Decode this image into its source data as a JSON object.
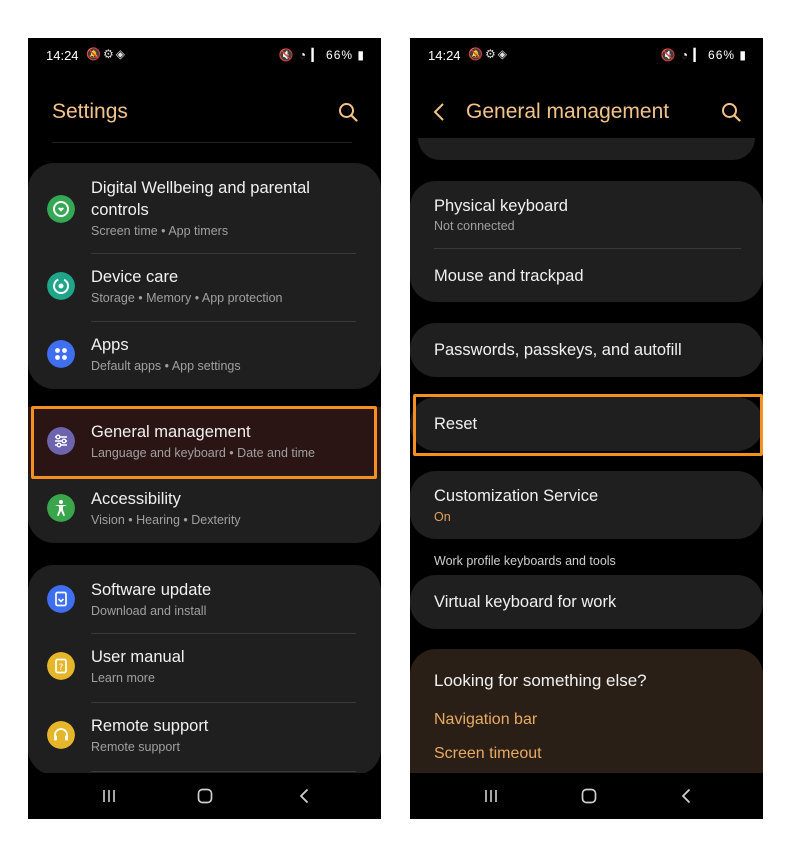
{
  "left": {
    "status": {
      "time": "14:24",
      "battery": "66%"
    },
    "header": {
      "title": "Settings"
    },
    "items": [
      {
        "title_line1": "Digital Wellbeing and parental",
        "title_line2": "controls",
        "sub": "Screen time  •  App timers"
      },
      {
        "title": "Device care",
        "sub": "Storage  •  Memory  •  App protection"
      },
      {
        "title": "Apps",
        "sub": "Default apps  •  App settings"
      },
      {
        "title": "General management",
        "sub": "Language and keyboard  •  Date and time"
      },
      {
        "title": "Accessibility",
        "sub": "Vision  •  Hearing  •  Dexterity"
      },
      {
        "title": "Software update",
        "sub": "Download and install"
      },
      {
        "title": "User manual",
        "sub": "Learn more"
      },
      {
        "title": "Remote support",
        "sub": "Remote support"
      }
    ],
    "icon_colors": {
      "digital_wellbeing": "#34a853",
      "device_care": "#1ea58a",
      "apps": "#3f6ff0",
      "general_management": "#6e64ad",
      "accessibility": "#3aa54a",
      "software_update": "#3f6ff0",
      "user_manual": "#e5b52a",
      "remote_support": "#e5b52a"
    },
    "highlight_color": "#f39020"
  },
  "right": {
    "status": {
      "time": "14:24",
      "battery": "66%"
    },
    "header": {
      "title": "General management"
    },
    "items": [
      {
        "title": "Physical keyboard",
        "sub": "Not connected"
      },
      {
        "title": "Mouse and trackpad"
      },
      {
        "title": "Passwords, passkeys, and autofill"
      },
      {
        "title": "Reset"
      },
      {
        "title": "Customization Service",
        "sub": "On"
      },
      {
        "title": "Virtual keyboard for work"
      }
    ],
    "section_label": "Work profile keyboards and tools",
    "looking": {
      "title": "Looking for something else?",
      "links": [
        "Navigation bar",
        "Screen timeout"
      ]
    }
  }
}
